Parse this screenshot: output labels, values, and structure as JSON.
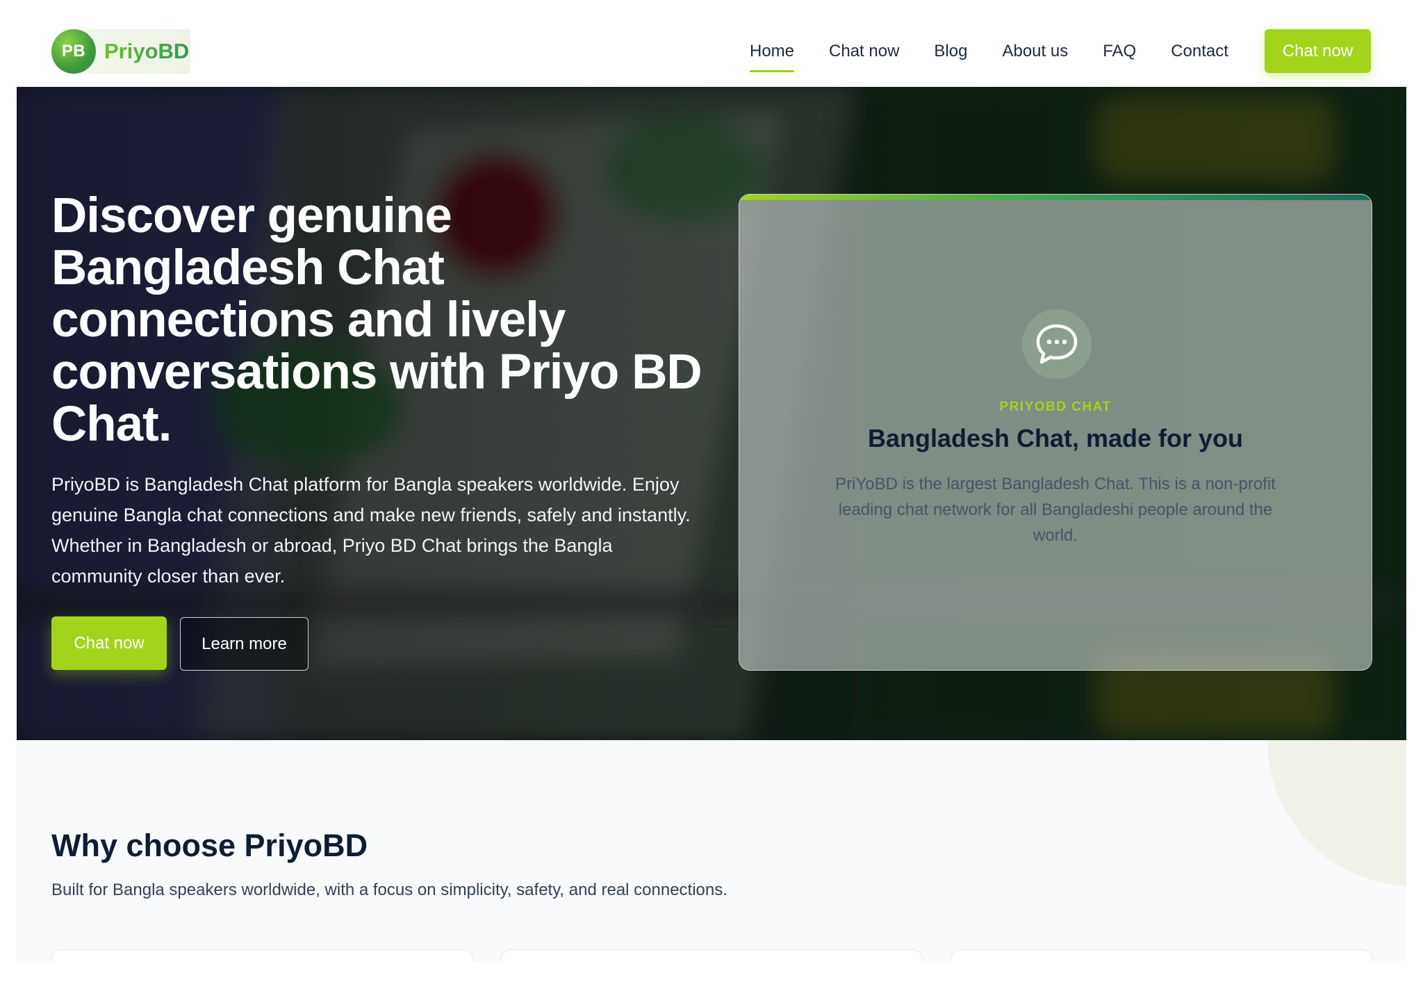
{
  "brand": {
    "badge": "PB",
    "name": "PriyoBD"
  },
  "nav": {
    "links": [
      {
        "label": "Home",
        "active": true
      },
      {
        "label": "Chat now",
        "active": false
      },
      {
        "label": "Blog",
        "active": false
      },
      {
        "label": "About us",
        "active": false
      },
      {
        "label": "FAQ",
        "active": false
      },
      {
        "label": "Contact",
        "active": false
      }
    ],
    "cta": "Chat now"
  },
  "hero": {
    "title": "Discover genuine Bangladesh Chat connections and lively conversations with Priyo BD Chat.",
    "description": "PriyoBD is Bangladesh Chat platform for Bangla speakers worldwide. Enjoy genuine Bangla chat connections and make new friends, safely and instantly. Whether in Bangladesh or abroad, Priyo BD Chat brings the Bangla community closer than ever.",
    "primary_button": "Chat now",
    "secondary_button": "Learn more"
  },
  "card": {
    "icon": "chat-bubble-icon",
    "kicker": "PRIYOBD CHAT",
    "title": "Bangladesh Chat, made for you",
    "text": "PriYoBD is the largest Bangladesh Chat. This is a non-profit leading chat network for all Bangladeshi people around the world."
  },
  "why": {
    "title": "Why choose PriyoBD",
    "subtitle": "Built for Bangla speakers worldwide, with a focus on simplicity, safety, and real connections."
  },
  "colors": {
    "accent": "#a4d31b",
    "brand_green": "#2d9a5a",
    "dark_text": "#0f1d33"
  }
}
